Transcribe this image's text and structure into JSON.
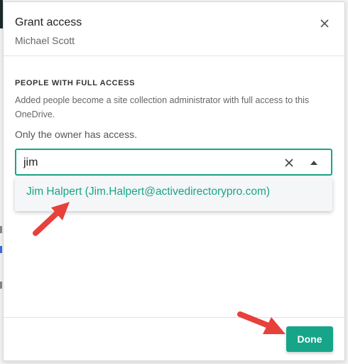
{
  "dialog": {
    "title": "Grant access",
    "subtitle": "Michael Scott",
    "close_icon": "close-icon"
  },
  "access": {
    "heading": "PEOPLE WITH FULL ACCESS",
    "description": "Added people become a site collection administrator with full access to this OneDrive.",
    "owner_note": "Only the owner has access."
  },
  "search": {
    "value": "jim",
    "clear_icon": "close-icon",
    "dropdown_icon": "caret-up-icon"
  },
  "suggestions": [
    {
      "label": "Jim Halpert (Jim.Halpert@activedirectorypro.com)"
    }
  ],
  "footer": {
    "done_label": "Done"
  },
  "colors": {
    "accent": "#17a589",
    "arrow": "#e8403a"
  }
}
